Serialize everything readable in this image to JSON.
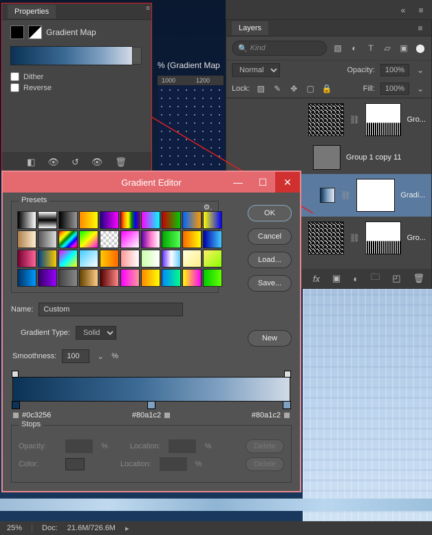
{
  "doc_tab": "% (Gradient Map",
  "ruler": {
    "a": "1000",
    "b": "1200"
  },
  "properties": {
    "title": "Properties",
    "label": "Gradient Map",
    "dither": "Dither",
    "reverse": "Reverse"
  },
  "layers": {
    "title": "Layers",
    "search_placeholder": "Kind",
    "blend_mode": "Normal",
    "opacity_label": "Opacity:",
    "opacity_value": "100%",
    "lock_label": "Lock:",
    "fill_label": "Fill:",
    "fill_value": "100%",
    "entries": [
      {
        "name": "Gro..."
      },
      {
        "name": "Group 1 copy 11"
      },
      {
        "name": "Gradi..."
      },
      {
        "name": "Gro..."
      }
    ],
    "fx_label": "fx"
  },
  "gedit": {
    "title": "Gradient Editor",
    "presets_label": "Presets",
    "buttons": {
      "ok": "OK",
      "cancel": "Cancel",
      "load": "Load...",
      "save": "Save...",
      "new": "New"
    },
    "name_label": "Name:",
    "name_value": "Custom",
    "type_label": "Gradient Type:",
    "type_value": "Solid",
    "smooth_label": "Smoothness:",
    "smooth_value": "100",
    "pct": "%",
    "stop_colors": {
      "a": "#0c3256",
      "b": "#80a1c2",
      "c": "#80a1c2"
    },
    "stops_label": "Stops",
    "opacity_label": "Opacity:",
    "location_label": "Location:",
    "color_label": "Color:",
    "delete_label": "Delete"
  },
  "swatches": [
    "linear-gradient(90deg,#000,#fff)",
    "linear-gradient(#fff,#000,#fff)",
    "linear-gradient(90deg,#000,#999)",
    "linear-gradient(90deg,#f80,#ff0)",
    "linear-gradient(90deg,#208,#f0f)",
    "linear-gradient(90deg,red,orange,yellow,green,blue,purple)",
    "linear-gradient(90deg,#f0f,#0ff)",
    "linear-gradient(90deg,#c00,#0c0)",
    "linear-gradient(90deg,#06f,#f90)",
    "linear-gradient(90deg,#ff0,#00f)",
    "linear-gradient(90deg,#b08050,#fff0d0)",
    "linear-gradient(90deg,#555,#ddd)",
    "linear-gradient(135deg,red,orange,yellow,green,cyan,blue,magenta,red)",
    "linear-gradient(135deg,#0f0,#ff0,#f0f)",
    "repeating-conic-gradient(#ccc 0 25%,#fff 0 50%) 0/8px 8px",
    "linear-gradient(135deg,#f0f,#fff)",
    "linear-gradient(90deg,#60a,#f7c,#fff)",
    "linear-gradient(90deg,#0a0,#5f5)",
    "linear-gradient(90deg,#f60,#ff0)",
    "linear-gradient(90deg,#00a,#4cf)",
    "linear-gradient(90deg,#703,#f69)",
    "linear-gradient(90deg,#048,#fc0)",
    "linear-gradient(135deg,#f0f,#0ff,#ff0)",
    "linear-gradient(135deg,#4cf,#fff)",
    "linear-gradient(90deg,#fc0,#f60)",
    "linear-gradient(90deg,#f99,#fff)",
    "linear-gradient(90deg,#cfa,#fff)",
    "linear-gradient(90deg,#63f,#fff,#6cf)",
    "linear-gradient(135deg,#ffd,#fe8)",
    "linear-gradient(135deg,#fe6,#8f0)",
    "linear-gradient(90deg,#036,#09f)",
    "linear-gradient(90deg,#306,#90f)",
    "linear-gradient(90deg,#444,#888)",
    "linear-gradient(90deg,#640,#fc8)",
    "linear-gradient(90deg,#500,#f88)",
    "linear-gradient(90deg,#f0f,#f99)",
    "linear-gradient(90deg,#f80,#ff0)",
    "linear-gradient(90deg,#08f,#0f8)",
    "linear-gradient(90deg,#ff0,#f0f)",
    "linear-gradient(90deg,#0c0,#6f0)"
  ],
  "status": {
    "zoom": "25%",
    "doc_label": "Doc:",
    "doc_value": "21.6M/726.6M"
  }
}
